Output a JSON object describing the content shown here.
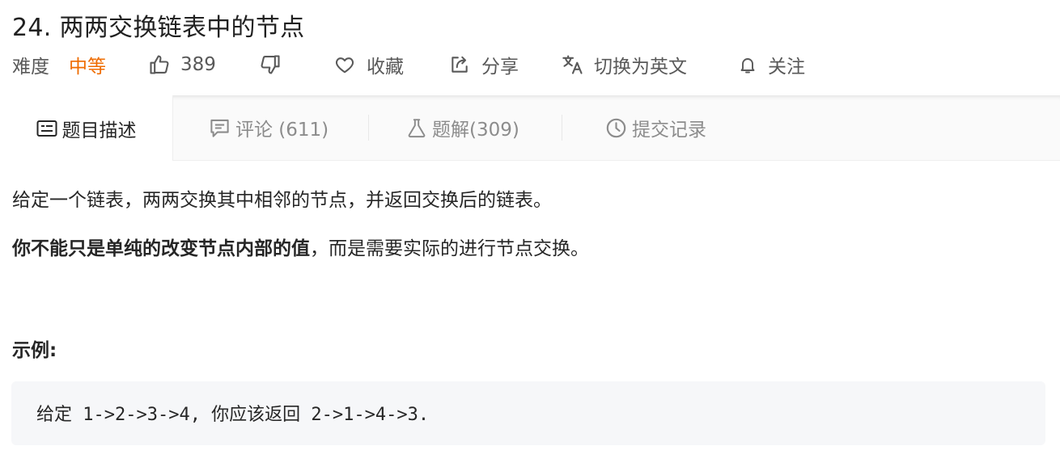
{
  "problem": {
    "title": "24. 两两交换链表中的节点",
    "difficulty_label": "难度",
    "difficulty_value": "中等",
    "likes": "389",
    "favorite_label": "收藏",
    "share_label": "分享",
    "translate_label": "切换为英文",
    "follow_label": "关注"
  },
  "tabs": [
    {
      "label": "题目描述",
      "icon": "description-icon"
    },
    {
      "label": "评论 (611)",
      "icon": "comment-icon"
    },
    {
      "label": "题解(309)",
      "icon": "flask-icon"
    },
    {
      "label": "提交记录",
      "icon": "clock-icon"
    }
  ],
  "description": {
    "line1": "给定一个链表，两两交换其中相邻的节点，并返回交换后的链表。",
    "line2_bold": "你不能只是单纯的改变节点内部的值",
    "line2_rest": "，而是需要实际的进行节点交换。",
    "example_label": "示例:",
    "example_code": "给定 1->2->3->4, 你应该返回 2->1->4->3."
  },
  "colors": {
    "difficulty_medium": "#ef6c00",
    "text_primary": "#262626",
    "text_secondary": "#595959",
    "tab_bar_bg": "#fafafa",
    "example_bg": "#f6f7f9"
  }
}
